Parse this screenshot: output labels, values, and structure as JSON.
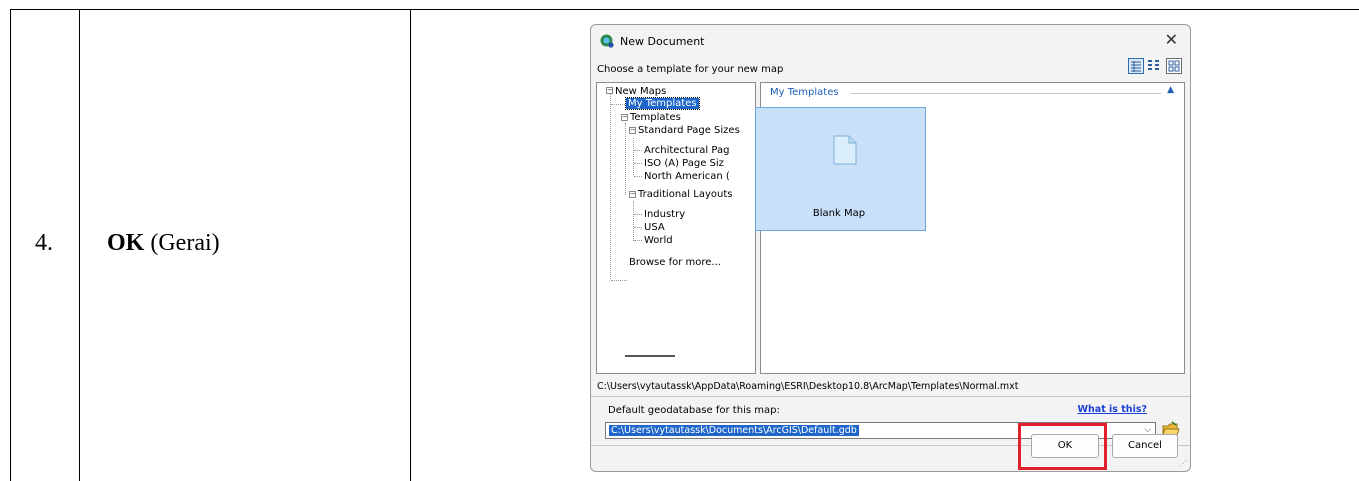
{
  "step": {
    "number": "4.",
    "action_bold": "OK",
    "action_rest": " (Gerai)"
  },
  "dialog": {
    "title": "New Document",
    "close_glyph": "✕",
    "subtitle": "Choose a template for your new map",
    "tree": {
      "new_maps": "New Maps",
      "my_templates": "My Templates",
      "templates": "Templates",
      "standard_page_sizes": "Standard Page Sizes",
      "architectural": "Architectural Pag",
      "iso": "ISO (A) Page Siz",
      "north_american": "North American (",
      "traditional_layouts": "Traditional Layouts",
      "industry": "Industry",
      "usa": "USA",
      "world": "World",
      "browse": "Browse for more..."
    },
    "group_header": "My Templates",
    "tile_label": "Blank Map",
    "template_path": "C:\\Users\\vytautassk\\AppData\\Roaming\\ESRI\\Desktop10.8\\ArcMap\\Templates\\Normal.mxt",
    "geodb_label": "Default geodatabase for this map:",
    "what_link": "What is this?",
    "geodb_value": "C:\\Users\\vytautassk\\Documents\\ArcGIS\\Default.gdb",
    "ok_label": "OK",
    "cancel_label": "Cancel",
    "icons": {
      "app": "arcmap-globe-icon",
      "close": "close-icon",
      "views": [
        "details-view-icon",
        "list-view-icon",
        "thumbnail-view-icon"
      ],
      "tile": "blank-document-icon",
      "folder": "open-folder-icon"
    },
    "colors": {
      "selection": "#1e66c9",
      "link": "#1a3fd6",
      "tile_bg": "#c8e0f8",
      "highlight": "#e0202a"
    }
  }
}
